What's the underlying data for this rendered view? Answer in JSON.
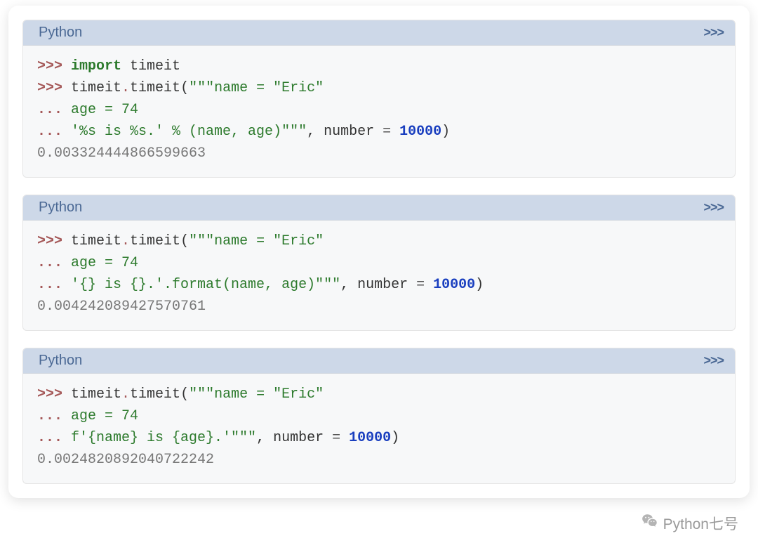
{
  "blocks": [
    {
      "lang": "Python",
      "toggle": ">>>",
      "lines": [
        [
          {
            "cls": "tok-prompt",
            "t": ">>> "
          },
          {
            "cls": "tok-kw",
            "t": "import"
          },
          {
            "cls": "",
            "t": " "
          },
          {
            "cls": "tok-name",
            "t": "timeit"
          }
        ],
        [
          {
            "cls": "tok-prompt",
            "t": ">>> "
          },
          {
            "cls": "tok-name",
            "t": "timeit"
          },
          {
            "cls": "tok-dot",
            "t": "."
          },
          {
            "cls": "tok-name",
            "t": "timeit"
          },
          {
            "cls": "tok-punct",
            "t": "("
          },
          {
            "cls": "tok-str",
            "t": "\"\"\"name = \"Eric\""
          }
        ],
        [
          {
            "cls": "tok-cont",
            "t": "... "
          },
          {
            "cls": "tok-str",
            "t": "age = 74"
          }
        ],
        [
          {
            "cls": "tok-cont",
            "t": "... "
          },
          {
            "cls": "tok-str",
            "t": "'%s is %s.' % (name, age)\"\"\""
          },
          {
            "cls": "tok-punct",
            "t": ", "
          },
          {
            "cls": "tok-param",
            "t": "number "
          },
          {
            "cls": "tok-op",
            "t": "="
          },
          {
            "cls": "",
            "t": " "
          },
          {
            "cls": "tok-num",
            "t": "10000"
          },
          {
            "cls": "tok-punct",
            "t": ")"
          }
        ],
        [
          {
            "cls": "tok-out",
            "t": "0.003324444866599663"
          }
        ]
      ]
    },
    {
      "lang": "Python",
      "toggle": ">>>",
      "lines": [
        [
          {
            "cls": "tok-prompt",
            "t": ">>> "
          },
          {
            "cls": "tok-name",
            "t": "timeit"
          },
          {
            "cls": "tok-dot",
            "t": "."
          },
          {
            "cls": "tok-name",
            "t": "timeit"
          },
          {
            "cls": "tok-punct",
            "t": "("
          },
          {
            "cls": "tok-str",
            "t": "\"\"\"name = \"Eric\""
          }
        ],
        [
          {
            "cls": "tok-cont",
            "t": "... "
          },
          {
            "cls": "tok-str",
            "t": "age = 74"
          }
        ],
        [
          {
            "cls": "tok-cont",
            "t": "... "
          },
          {
            "cls": "tok-str",
            "t": "'{} is {}.'.format(name, age)\"\"\""
          },
          {
            "cls": "tok-punct",
            "t": ", "
          },
          {
            "cls": "tok-param",
            "t": "number "
          },
          {
            "cls": "tok-op",
            "t": "="
          },
          {
            "cls": "",
            "t": " "
          },
          {
            "cls": "tok-num",
            "t": "10000"
          },
          {
            "cls": "tok-punct",
            "t": ")"
          }
        ],
        [
          {
            "cls": "tok-out",
            "t": "0.004242089427570761"
          }
        ]
      ]
    },
    {
      "lang": "Python",
      "toggle": ">>>",
      "lines": [
        [
          {
            "cls": "tok-prompt",
            "t": ">>> "
          },
          {
            "cls": "tok-name",
            "t": "timeit"
          },
          {
            "cls": "tok-dot",
            "t": "."
          },
          {
            "cls": "tok-name",
            "t": "timeit"
          },
          {
            "cls": "tok-punct",
            "t": "("
          },
          {
            "cls": "tok-str",
            "t": "\"\"\"name = \"Eric\""
          }
        ],
        [
          {
            "cls": "tok-cont",
            "t": "... "
          },
          {
            "cls": "tok-str",
            "t": "age = 74"
          }
        ],
        [
          {
            "cls": "tok-cont",
            "t": "... "
          },
          {
            "cls": "tok-str",
            "t": "f'{name} is {age}.'\"\"\""
          },
          {
            "cls": "tok-punct",
            "t": ", "
          },
          {
            "cls": "tok-param",
            "t": "number "
          },
          {
            "cls": "tok-op",
            "t": "="
          },
          {
            "cls": "",
            "t": " "
          },
          {
            "cls": "tok-num",
            "t": "10000"
          },
          {
            "cls": "tok-punct",
            "t": ")"
          }
        ],
        [
          {
            "cls": "tok-out",
            "t": "0.0024820892040722242"
          }
        ]
      ]
    }
  ],
  "watermark": {
    "text": "Python七号"
  }
}
